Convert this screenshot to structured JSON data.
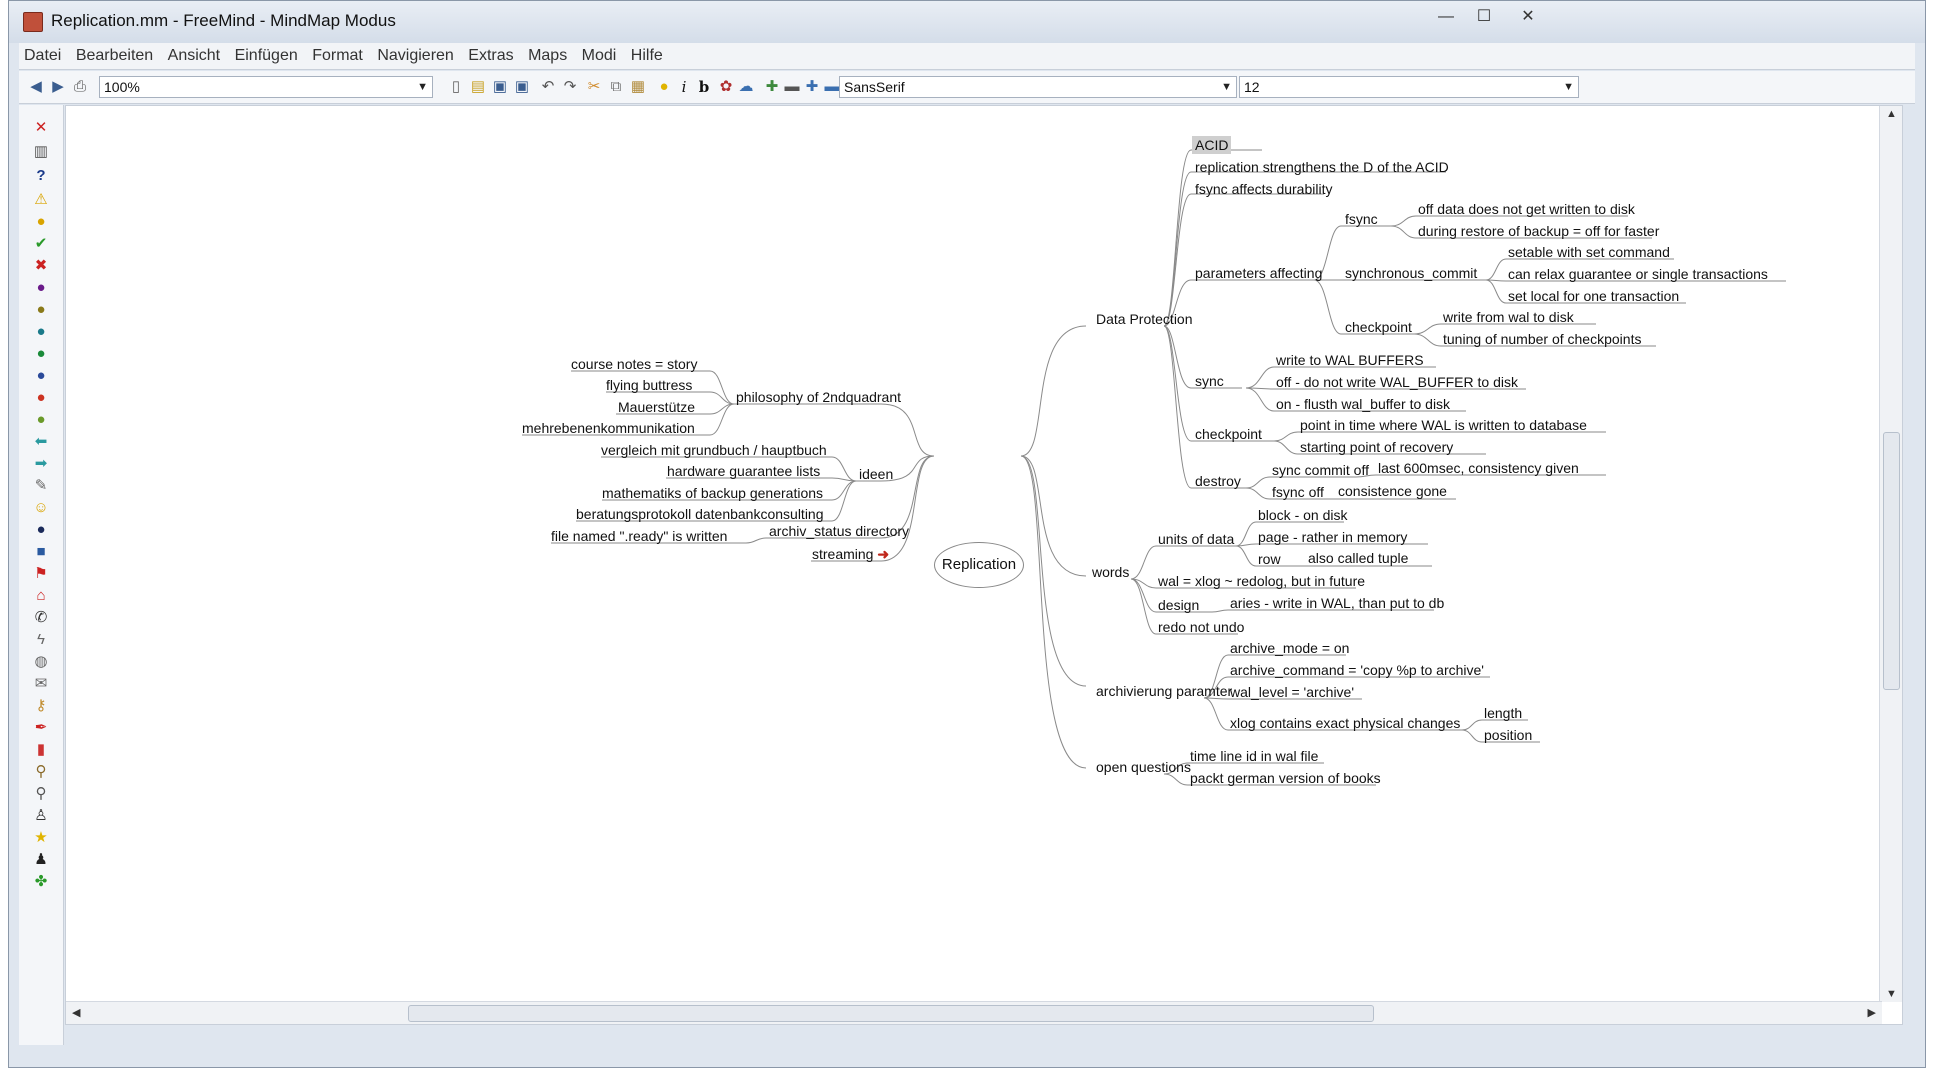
{
  "window": {
    "title": "Replication.mm - FreeMind - MindMap Modus",
    "minimize": "—",
    "maximize": "☐",
    "close": "✕"
  },
  "menu": [
    "Datei",
    "Bearbeiten",
    "Ansicht",
    "Einfügen",
    "Format",
    "Navigieren",
    "Extras",
    "Maps",
    "Modi",
    "Hilfe"
  ],
  "toolbar": {
    "zoom": "100%",
    "font_family": "SansSerif",
    "font_size": "12",
    "italic": "i",
    "bold": "b"
  },
  "sidebar_icons": [
    "remove-icon",
    "trash-icon",
    "question-icon",
    "warning-icon",
    "idea-icon",
    "check-icon",
    "cross-icon",
    "priority-1-icon",
    "priority-2-icon",
    "priority-3-icon",
    "priority-4-icon",
    "priority-5-icon",
    "priority-6-icon",
    "priority-7-icon",
    "back-icon",
    "forward-icon",
    "attach-icon",
    "smiley-icon",
    "bomb-icon",
    "book-icon",
    "flag-icon",
    "home-icon",
    "phone-icon",
    "flash-icon",
    "chat-icon",
    "mail-icon",
    "key-icon",
    "pen-icon",
    "bell-icon",
    "wizard-icon",
    "magnify-icon",
    "person-icon",
    "star-icon",
    "penguin-icon",
    "clover-icon"
  ],
  "mindmap": {
    "root": "Replication",
    "data_protection": {
      "label": "Data Protection",
      "acid": "ACID",
      "replication_strengthens": "replication strengthens the D of the ACID",
      "fsync_durability": "fsync affects durability",
      "parameters": {
        "label": "parameters affecting",
        "fsync": {
          "label": "fsync",
          "off_data": "off data does not get written to disk",
          "restore": "during restore of backup = off for faster"
        },
        "sync_commit": {
          "label": "synchronous_commit",
          "setable": "setable with set command",
          "relax": "can relax guarantee or single transactions",
          "local": "set local for one transaction"
        },
        "checkpoint": {
          "label": "checkpoint",
          "write_wal": "write from wal to disk",
          "tuning": "tuning of number of checkpoints"
        }
      },
      "sync": {
        "label": "sync",
        "write": "write to WAL BUFFERS",
        "off": "off - do not write WAL_BUFFER to disk",
        "on": "on - flusth wal_buffer to disk"
      },
      "checkpoint": {
        "label": "checkpoint",
        "point": "point in time where WAL is written to database",
        "start": "starting point of recovery"
      },
      "destroy": {
        "label": "destroy",
        "sync_commit_off": "sync commit off",
        "last600": "last 600msec, consistency given",
        "fsync_off": "fsync off",
        "gone": "consistence gone"
      }
    },
    "words": {
      "label": "words",
      "units": {
        "label": "units of data",
        "block": "block - on disk",
        "page": "page - rather in memory",
        "row": "row",
        "tuple": "also called tuple"
      },
      "wal": "wal = xlog ~ redolog, but in future",
      "design": {
        "label": "design",
        "aries": "aries - write in WAL, than put to db"
      },
      "redo": "redo not undo"
    },
    "archivierung": {
      "label": "archivierung paramter",
      "mode": "archive_mode = on",
      "command": "archive_command = 'copy %p to archive'",
      "level": "wal_level = 'archive'",
      "xlog": {
        "label": "xlog contains exact physical changes",
        "length": "length",
        "position": "position"
      }
    },
    "open_questions": {
      "label": "open questions",
      "timeline": "time line id in wal file",
      "packt": "packt german version of books"
    },
    "philosophy": {
      "label": "philosophy of 2ndquadrant",
      "course": "course notes = story",
      "flying": "flying buttress",
      "mauer": "Mauerstütze",
      "mehr": "mehrebenenkommunikation"
    },
    "ideen": {
      "label": "ideen",
      "vergleich": "vergleich mit grundbuch / hauptbuch",
      "hardware": "hardware guarantee lists",
      "mathematiks": "mathematiks of backup generations",
      "beratung": "beratungsprotokoll datenbankconsulting"
    },
    "archiv_status": {
      "label": "archiv_status directory",
      "file": "file named \".ready\" is written"
    },
    "streaming": "streaming",
    "streaming_arrow": "➜"
  },
  "colors": {
    "edge": "#8a8a8a",
    "selection": "#cfcfcf",
    "accent": "#c0281c"
  }
}
